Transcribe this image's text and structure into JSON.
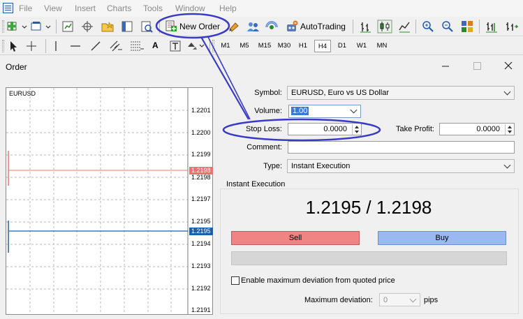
{
  "menu": {
    "items": [
      "File",
      "View",
      "Insert",
      "Charts",
      "Tools",
      "Window",
      "Help"
    ]
  },
  "toolbar": {
    "new_order_label": "New Order",
    "autotrading_label": "AutoTrading",
    "timeframes": [
      "M1",
      "M5",
      "M15",
      "M30",
      "H1",
      "H4",
      "D1",
      "W1",
      "MN"
    ],
    "active_timeframe": "H4",
    "text_tool_label": "A"
  },
  "dialog": {
    "title": "Order",
    "symbol_label": "Symbol:",
    "symbol_value": "EURUSD, Euro vs US Dollar",
    "volume_label": "Volume:",
    "volume_value": "1.00",
    "stop_loss_label": "Stop Loss:",
    "stop_loss_value": "0.0000",
    "take_profit_label": "Take Profit:",
    "take_profit_value": "0.0000",
    "comment_label": "Comment:",
    "comment_value": "",
    "type_label": "Type:",
    "type_value": "Instant Execution",
    "execution_title": "Instant Execution",
    "quote": "1.2195 / 1.2198",
    "sell_label": "Sell",
    "buy_label": "Buy",
    "progress_fraction": 0,
    "deviation_checkbox_label": "Enable maximum deviation from quoted price",
    "deviation_checked": false,
    "max_deviation_label": "Maximum deviation:",
    "max_deviation_value": "0",
    "pips_label": "pips"
  },
  "chart": {
    "symbol": "EURUSD",
    "price_ticks": [
      "1.2201",
      "1.2200",
      "1.2199",
      "1.2198",
      "1.2197",
      "1.2195",
      "1.2194",
      "1.2193",
      "1.2192",
      "1.2191"
    ],
    "ask_price": "1.2198",
    "bid_price": "1.2195",
    "ask_color": "#f07070",
    "bid_color": "#1f5fa8"
  },
  "colors": {
    "sell": "#f08484",
    "buy": "#9ab8f2",
    "annotation": "#3a3ac8"
  }
}
